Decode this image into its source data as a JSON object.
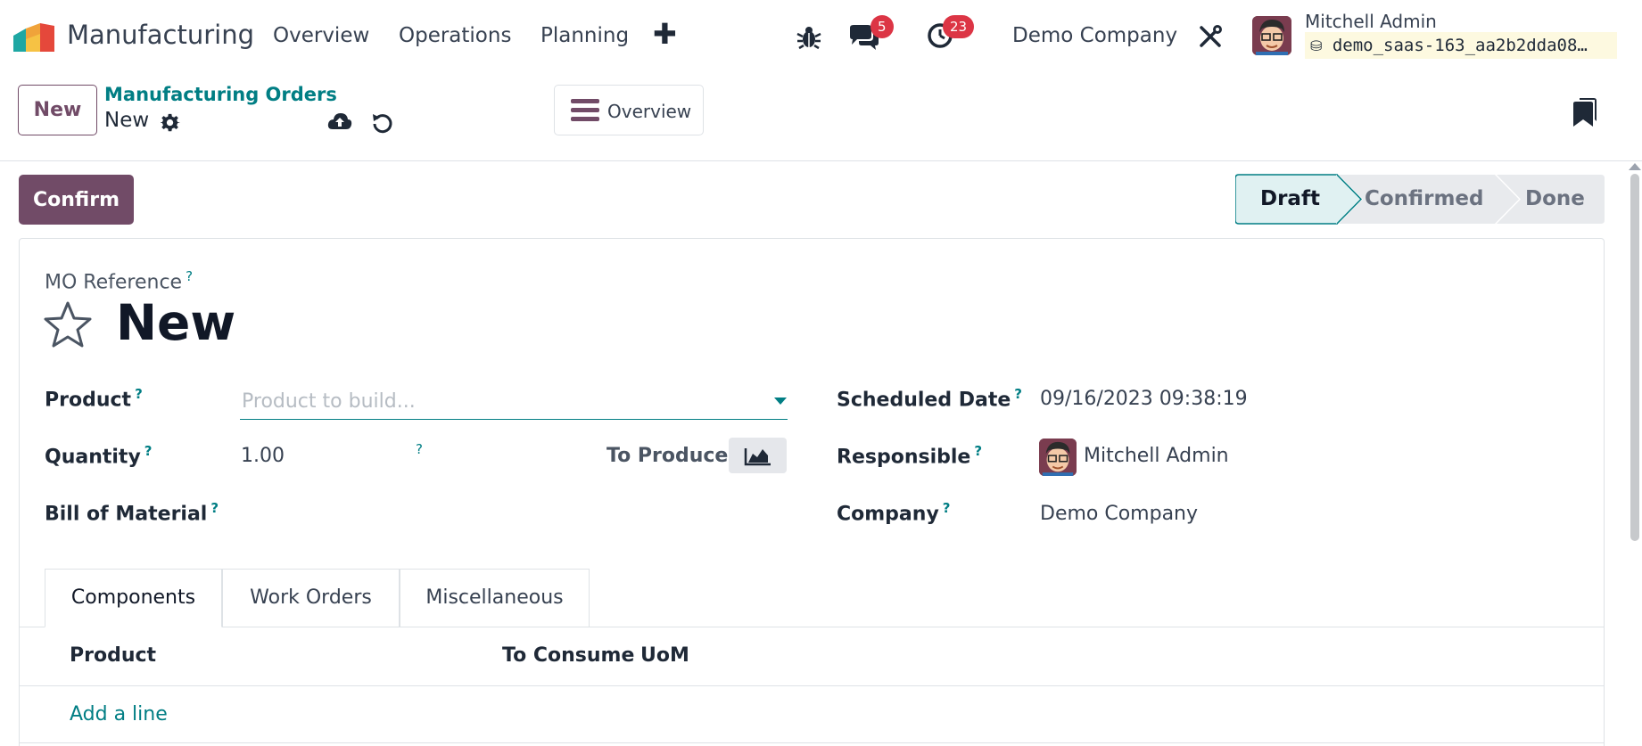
{
  "navbar": {
    "app_name": "Manufacturing",
    "menu": [
      "Overview",
      "Operations",
      "Planning"
    ],
    "messages_count": "5",
    "activities_count": "23",
    "company": "Demo Company",
    "user_name": "Mitchell Admin",
    "db_name": "demo_saas-163_aa2b2dda08…"
  },
  "control_panel": {
    "new_label": "New",
    "breadcrumb_parent": "Manufacturing Orders",
    "breadcrumb_current": "New",
    "overview_label": "Overview"
  },
  "actions": {
    "confirm_label": "Confirm"
  },
  "status": {
    "steps": [
      "Draft",
      "Confirmed",
      "Done"
    ],
    "current": "Draft"
  },
  "form": {
    "mo_reference_label": "MO Reference",
    "title": "New",
    "product_label": "Product",
    "product_placeholder": "Product to build...",
    "quantity_label": "Quantity",
    "quantity_value": "1.00",
    "to_produce_label": "To Produce",
    "bom_label": "Bill of Material",
    "scheduled_date_label": "Scheduled Date",
    "scheduled_date_value": "09/16/2023 09:38:19",
    "responsible_label": "Responsible",
    "responsible_value": "Mitchell Admin",
    "company_label": "Company",
    "company_value": "Demo Company",
    "qmark": "?"
  },
  "tabs": [
    "Components",
    "Work Orders",
    "Miscellaneous"
  ],
  "components_table": {
    "headers": [
      "Product",
      "To Consume",
      "UoM"
    ],
    "add_line_label": "Add a line"
  },
  "colors": {
    "brand": "#714b67",
    "accent": "#017e84",
    "badge": "#dc3545"
  }
}
